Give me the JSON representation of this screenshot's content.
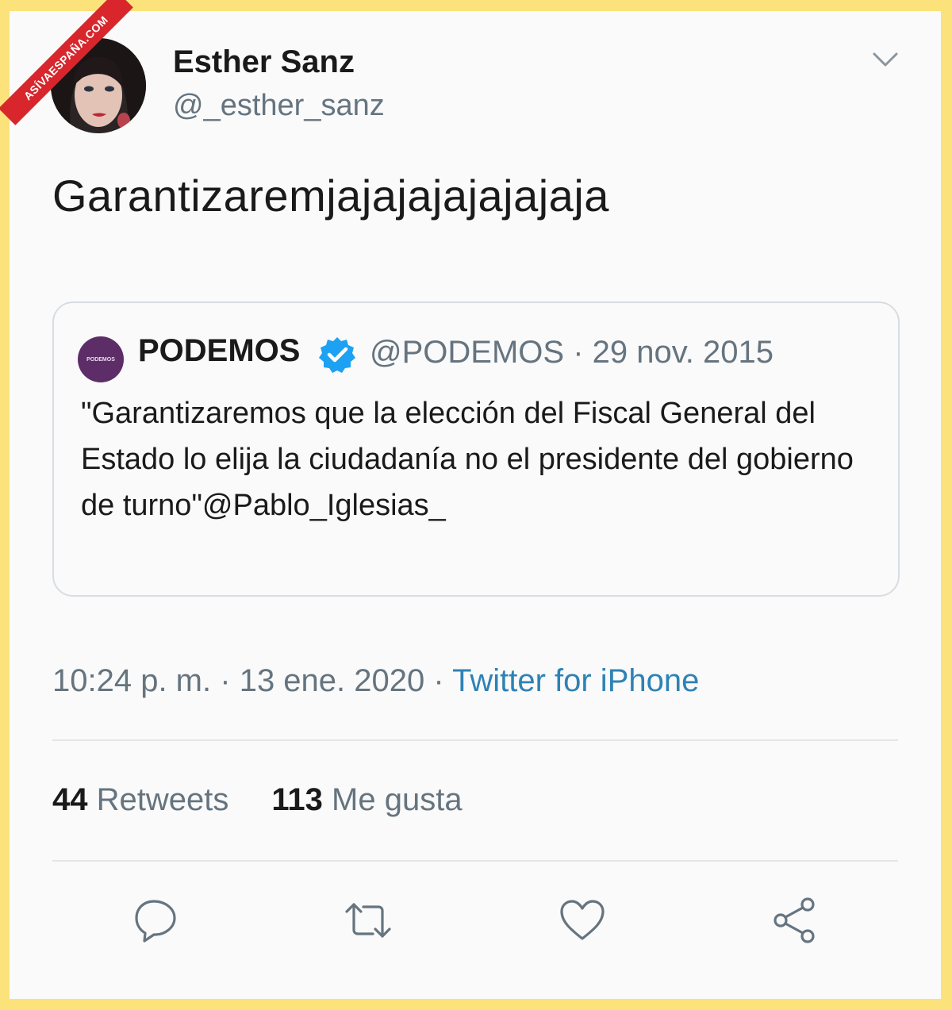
{
  "watermark": "ASÍVAESPAÑA.COM",
  "tweet": {
    "author_name": "Esther Sanz",
    "author_handle": "@_esther_sanz",
    "text": "Garantizaremjajajajajajajaja",
    "time": "10:24 p. m.",
    "separator": "·",
    "date": "13 ene. 2020",
    "source": "Twitter for iPhone",
    "retweet_count": "44",
    "retweet_label": "Retweets",
    "like_count": "113",
    "like_label": "Me gusta"
  },
  "quoted": {
    "avatar_text": "PODEMOS",
    "name": "PODEMOS",
    "handle": "@PODEMOS",
    "date": "29 nov. 2015",
    "text": "\"Garantizaremos que la elección del Fiscal General del Estado lo elija la ciudadanía no el presidente del gobierno de turno\"@Pablo_Iglesias_"
  },
  "icons": {
    "menu": "chevron-down-icon",
    "reply": "reply-icon",
    "retweet": "retweet-icon",
    "like": "heart-icon",
    "share": "share-icon",
    "verified": "verified-badge-icon"
  },
  "colors": {
    "frame": "#fbe27a",
    "text": "#1a1a1a",
    "secondary": "#65747f",
    "link": "#2e82b5",
    "verified": "#1da1f2",
    "podemos": "#5d2d68",
    "watermark": "#d8262c"
  }
}
